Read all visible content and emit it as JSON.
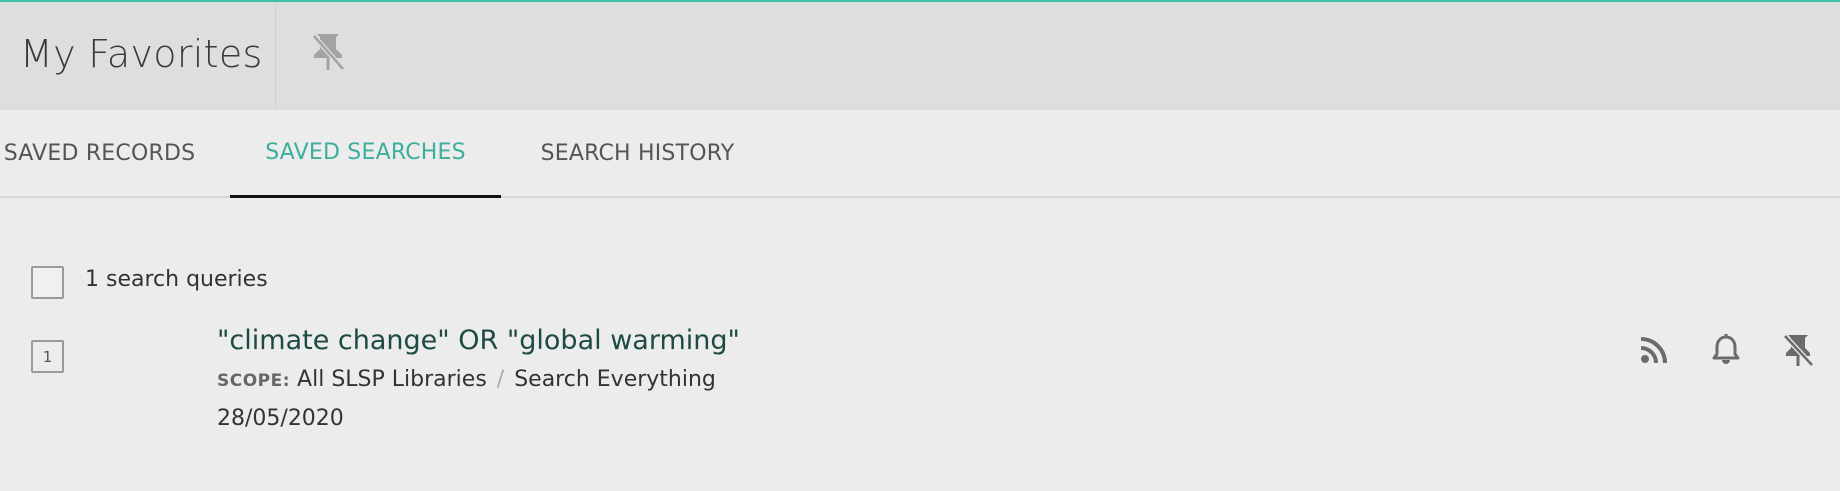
{
  "header": {
    "title": "My Favorites",
    "pin_icon": "unpin-icon"
  },
  "tabs": [
    {
      "label": "SAVED RECORDS",
      "active": false
    },
    {
      "label": "SAVED SEARCHES",
      "active": true
    },
    {
      "label": "SEARCH HISTORY",
      "active": false
    }
  ],
  "list": {
    "count_label": "1 search queries",
    "items": [
      {
        "index": "1",
        "query": "\"climate change\" OR \"global warming\"",
        "scope_label": "SCOPE:",
        "scope": "All SLSP Libraries",
        "scope_separator": "/",
        "scope_tab": "Search Everything",
        "date": "28/05/2020",
        "actions": [
          "rss-icon",
          "bell-icon",
          "unpin-icon"
        ]
      }
    ]
  },
  "colors": {
    "accent": "#3cbfa8",
    "active_tab": "#3cae9e",
    "query_link": "#1e4a44",
    "header_bg": "#dedede",
    "page_bg": "#ececec"
  }
}
